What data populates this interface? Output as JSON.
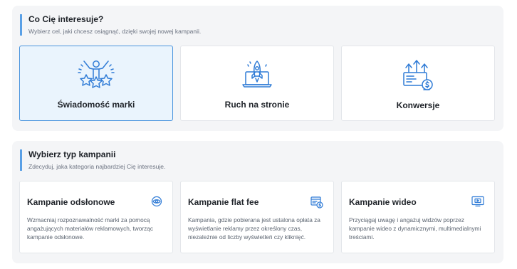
{
  "goal_section": {
    "title": "Co Cię interesuje?",
    "subtitle": "Wybierz cel, jaki chcesz osiągnąć, dzięki swojej nowej kampanii.",
    "cards": [
      {
        "label": "Świadomość marki",
        "icon": "celebrating-figure-stars-icon",
        "selected": true
      },
      {
        "label": "Ruch na stronie",
        "icon": "rocket-laptop-icon",
        "selected": false
      },
      {
        "label": "Konwersje",
        "icon": "chart-arrows-coin-icon",
        "selected": false
      }
    ]
  },
  "type_section": {
    "title": "Wybierz typ kampanii",
    "subtitle": "Zdecyduj, jaka kategoria najbardziej Cię interesuje.",
    "cards": [
      {
        "title": "Kampanie odsłonowe",
        "icon": "eye-icon",
        "description": "Wzmacniaj rozpoznawalność marki za pomocą angażujących materiałów reklamowych, tworząc kampanie odsłonowe."
      },
      {
        "title": "Kampanie flat fee",
        "icon": "browser-dollar-icon",
        "description": "Kampania, gdzie pobierana jest ustalona opłata za wyświetlanie reklamy przez określony czas, niezależnie od liczby wyświetleń czy kliknięć."
      },
      {
        "title": "Kampanie wideo",
        "icon": "video-screen-icon",
        "description": "Przyciągaj uwagę i angażuj widzów poprzez kampanie wideo z dynamicznymi, multimedialnymi treściami."
      }
    ]
  },
  "colors": {
    "accent": "#2f7bd6",
    "selected_bg": "#eaf4fd",
    "selected_border": "#4a95de",
    "panel_bg": "#f4f5f7"
  }
}
